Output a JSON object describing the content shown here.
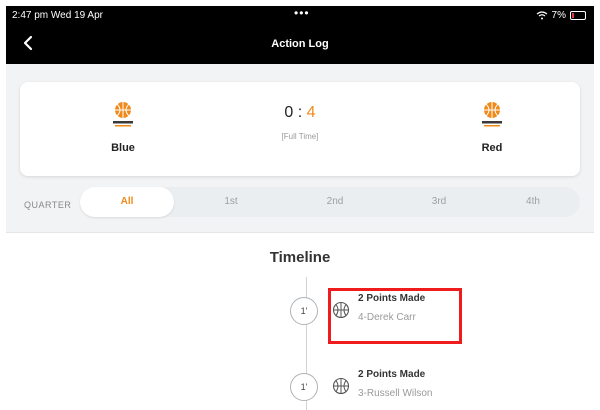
{
  "status_bar": {
    "time": "2:47 pm  Wed 19 Apr",
    "dots": "•••",
    "battery": "7%"
  },
  "header": {
    "title": "Action Log",
    "back_icon": "chevron-left-icon"
  },
  "scoreboard": {
    "home": {
      "name": "Blue",
      "logo": "basketball-logo-icon"
    },
    "away": {
      "name": "Red",
      "logo": "basketball-logo-icon"
    },
    "home_score": "0",
    "separator": ":",
    "away_score": "4",
    "status": "[Full Time]"
  },
  "quarter": {
    "label": "QUARTER",
    "tabs": [
      "All",
      "1st",
      "2nd",
      "3rd",
      "4th"
    ],
    "selected": "All"
  },
  "timeline": {
    "title": "Timeline",
    "events": [
      {
        "minute": "1'",
        "action": "2 Points Made",
        "player": "4-Derek Carr",
        "icon": "basketball-icon"
      },
      {
        "minute": "1'",
        "action": "2 Points Made",
        "player": "3-Russell Wilson",
        "icon": "basketball-icon"
      }
    ]
  },
  "colors": {
    "accent": "#f08a1a",
    "highlight": "#ee1c1c",
    "header_bg": "#000000"
  }
}
